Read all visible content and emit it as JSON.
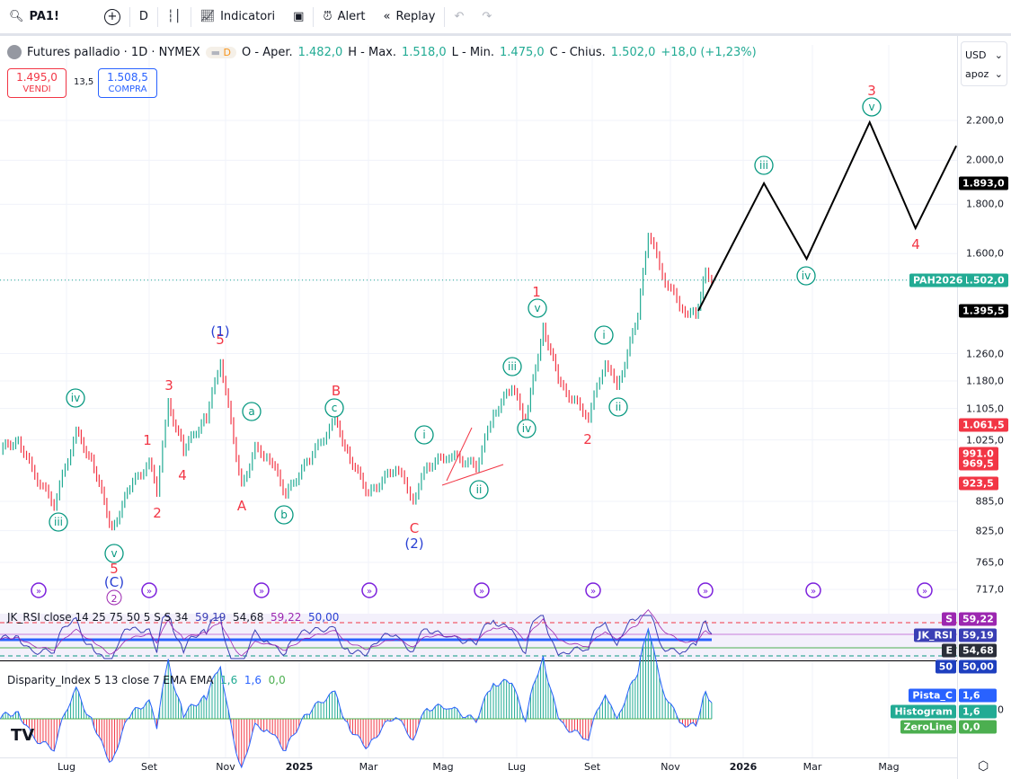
{
  "toolbar": {
    "symbol": "PA1!",
    "interval": "D",
    "indicators": "Indicatori",
    "alert": "Alert",
    "replay": "Replay"
  },
  "legend": {
    "title": "Futures palladio · 1D · NYMEX",
    "badge": "D",
    "open_label": "O - Aper.",
    "open": "1.482,0",
    "high_label": "H - Max.",
    "high": "1.518,0",
    "low_label": "L - Min.",
    "low": "1.475,0",
    "close_label": "C - Chius.",
    "close": "1.502,0",
    "change": "+18,0 (+1,23%)"
  },
  "trade": {
    "sell_price": "1.495,0",
    "sell_label": "VENDI",
    "spread": "13,5",
    "buy_price": "1.508,5",
    "buy_label": "COMPRA"
  },
  "axis_menu": {
    "currency": "USD",
    "mode": "apoz"
  },
  "price_ticks": [
    "2.200,0",
    "2.000,0",
    "1.800,0",
    "1.600,0",
    "1.260,0",
    "1.180,0",
    "1.105,0",
    "1.025,0",
    "885,0",
    "825,0",
    "765,0",
    "717,0"
  ],
  "price_tags": [
    {
      "text": "1.893,0",
      "color": "#000000"
    },
    {
      "text": "1.502,0",
      "label": "PAH2026",
      "color": "#22ab94"
    },
    {
      "text": "1.395,5",
      "color": "#000000"
    },
    {
      "text": "1.061,5",
      "color": "#f23645"
    },
    {
      "text": "991,0",
      "color": "#f23645"
    },
    {
      "text": "969,5",
      "color": "#f23645"
    },
    {
      "text": "923,5",
      "color": "#f23645"
    }
  ],
  "time_ticks": [
    "Lug",
    "Set",
    "Nov",
    "2025",
    "Mar",
    "Mag",
    "Lug",
    "Set",
    "Nov",
    "2026",
    "Mar",
    "Mag"
  ],
  "rsi": {
    "title": "JK_RSI close 14 25 75 50 5 S S 34",
    "v1": "59,19",
    "v2": "54,68",
    "v3": "59,22",
    "v4": "50,00",
    "tags": [
      {
        "label": "S",
        "value": "59,22",
        "color": "#9c27b0"
      },
      {
        "label": "JK_RSI",
        "value": "59,19",
        "color": "#3a3fb5"
      },
      {
        "label": "E",
        "value": "54,68",
        "color": "#2a2e39"
      },
      {
        "label": "50",
        "value": "50,00",
        "color": "#1e3fbf"
      }
    ]
  },
  "disparity": {
    "title": "Disparity_Index 5 13 close 7 EMA EMA",
    "v1": "1,6",
    "v2": "1,6",
    "v3": "0,0",
    "axis": "10,0",
    "tags": [
      {
        "label": "Pista_C",
        "value": "1,6",
        "color": "#2962ff"
      },
      {
        "label": "Histogram",
        "value": "1,6",
        "color": "#22ab94"
      },
      {
        "label": "ZeroLine",
        "value": "0,0",
        "color": "#4caf50"
      }
    ]
  },
  "chart_data": {
    "type": "line",
    "scale": "log",
    "ylim": [
      717,
      2200
    ],
    "xlim": [
      "2024-05-13",
      "2026-06-30"
    ],
    "grid": true,
    "series": [
      {
        "values": [
          [
            "2024-05-13",
            1003
          ],
          [
            "2024-05-26",
            1025
          ],
          [
            "2024-06-08",
            941
          ],
          [
            "2024-06-22",
            880
          ],
          [
            "2024-07-08",
            1045
          ],
          [
            "2024-07-21",
            962
          ],
          [
            "2024-08-04",
            826
          ],
          [
            "2024-08-17",
            917
          ],
          [
            "2024-08-31",
            970
          ],
          [
            "2024-09-07",
            910
          ],
          [
            "2024-09-16",
            1115
          ],
          [
            "2024-09-28",
            1003
          ],
          [
            "2024-10-16",
            1083
          ],
          [
            "2024-10-27",
            1240
          ],
          [
            "2024-11-14",
            917
          ],
          [
            "2024-11-25",
            1003
          ],
          [
            "2024-12-07",
            982
          ],
          [
            "2024-12-20",
            900
          ],
          [
            "2025-01-10",
            982
          ],
          [
            "2025-02-02",
            1072
          ],
          [
            "2025-02-15",
            982
          ],
          [
            "2025-03-01",
            900
          ],
          [
            "2025-03-23",
            962
          ],
          [
            "2025-04-07",
            890
          ],
          [
            "2025-04-18",
            962
          ],
          [
            "2025-05-06",
            990
          ],
          [
            "2025-05-28",
            962
          ],
          [
            "2025-06-12",
            1090
          ],
          [
            "2025-06-27",
            1164
          ],
          [
            "2025-07-08",
            1072
          ],
          [
            "2025-07-22",
            1343
          ],
          [
            "2025-08-06",
            1164
          ],
          [
            "2025-08-28",
            1085
          ],
          [
            "2025-09-11",
            1240
          ],
          [
            "2025-09-20",
            1155
          ],
          [
            "2025-10-06",
            1380
          ],
          [
            "2025-10-14",
            1680
          ],
          [
            "2025-10-27",
            1500
          ],
          [
            "2025-11-11",
            1400
          ],
          [
            "2025-11-22",
            1380
          ],
          [
            "2025-11-30",
            1540
          ],
          [
            "2025-12-05",
            1502
          ]
        ]
      },
      {
        "values": [
          [
            "2025-11-24",
            1395.5
          ],
          [
            "2026-01-19",
            1893
          ],
          [
            "2026-02-26",
            1580
          ],
          [
            "2026-04-16",
            2190
          ],
          [
            "2026-05-22",
            1700
          ],
          [
            "2026-06-24",
            2070
          ]
        ]
      }
    ],
    "annotations": [
      {
        "text": "iii",
        "kind": "circle"
      },
      {
        "text": "iv",
        "kind": "circle"
      },
      {
        "text": "v",
        "kind": "circle"
      },
      {
        "text": "a",
        "kind": "circle"
      },
      {
        "text": "b",
        "kind": "circle"
      },
      {
        "text": "c",
        "kind": "circle"
      },
      {
        "text": "i",
        "kind": "circle"
      },
      {
        "text": "ii",
        "kind": "circle"
      },
      {
        "text": "iii",
        "kind": "circle"
      },
      {
        "text": "iv",
        "kind": "circle"
      },
      {
        "text": "v",
        "kind": "circle"
      },
      {
        "text": "i",
        "kind": "circle"
      },
      {
        "text": "ii",
        "kind": "circle"
      },
      {
        "text": "iii",
        "kind": "circle"
      },
      {
        "text": "iv",
        "kind": "circle"
      },
      {
        "text": "v",
        "kind": "circle"
      },
      {
        "text": "5",
        "kind": "red"
      },
      {
        "text": "1",
        "kind": "red"
      },
      {
        "text": "2",
        "kind": "red"
      },
      {
        "text": "3",
        "kind": "red"
      },
      {
        "text": "4",
        "kind": "red"
      },
      {
        "text": "5",
        "kind": "red"
      },
      {
        "text": "A",
        "kind": "red"
      },
      {
        "text": "B",
        "kind": "red"
      },
      {
        "text": "C",
        "kind": "red"
      },
      {
        "text": "1",
        "kind": "red"
      },
      {
        "text": "2",
        "kind": "red"
      },
      {
        "text": "3",
        "kind": "red"
      },
      {
        "text": "4",
        "kind": "red"
      },
      {
        "text": "(C)",
        "kind": "blue"
      },
      {
        "text": "(1)",
        "kind": "blue"
      },
      {
        "text": "(2)",
        "kind": "blue"
      },
      {
        "text": "2",
        "kind": "purple"
      }
    ],
    "colors": {
      "up": "#22ab94",
      "down": "#f23645",
      "wave_green": "#089981",
      "wave_red": "#f23645",
      "wave_blue": "#2940d3",
      "forecast": "#000000"
    }
  }
}
